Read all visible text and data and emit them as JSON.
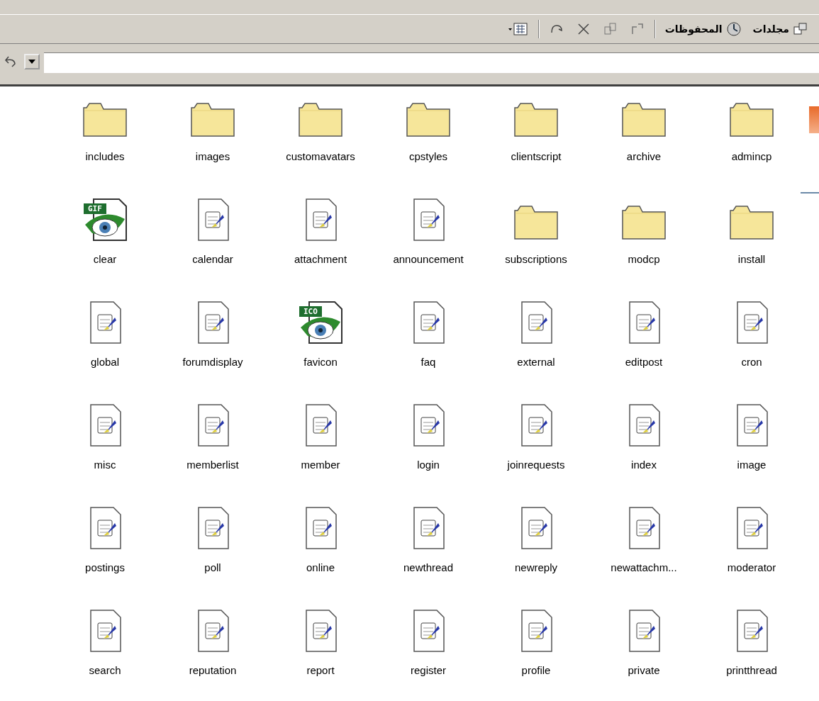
{
  "toolbar": {
    "buttons": [
      {
        "kind": "folders",
        "label": "مجلدات"
      },
      {
        "kind": "history",
        "label": "المحفوظات"
      },
      {
        "kind": "separator"
      },
      {
        "kind": "move"
      },
      {
        "kind": "copy"
      },
      {
        "kind": "delete"
      },
      {
        "kind": "undo"
      },
      {
        "kind": "separator"
      },
      {
        "kind": "views"
      }
    ]
  },
  "items": [
    {
      "kind": "folder",
      "name": "includes"
    },
    {
      "kind": "folder",
      "name": "images"
    },
    {
      "kind": "folder",
      "name": "customavatars"
    },
    {
      "kind": "folder",
      "name": "cpstyles"
    },
    {
      "kind": "folder",
      "name": "clientscript"
    },
    {
      "kind": "folder",
      "name": "archive"
    },
    {
      "kind": "folder",
      "name": "admincp"
    },
    {
      "kind": "image",
      "badge": "GIF",
      "name": "clear"
    },
    {
      "kind": "script",
      "name": "calendar"
    },
    {
      "kind": "script",
      "name": "attachment"
    },
    {
      "kind": "script",
      "name": "announcement"
    },
    {
      "kind": "folder",
      "name": "subscriptions"
    },
    {
      "kind": "folder",
      "name": "modcp"
    },
    {
      "kind": "folder",
      "name": "install"
    },
    {
      "kind": "script",
      "name": "global"
    },
    {
      "kind": "script",
      "name": "forumdisplay"
    },
    {
      "kind": "image",
      "badge": "ICO",
      "name": "favicon"
    },
    {
      "kind": "script",
      "name": "faq"
    },
    {
      "kind": "script",
      "name": "external"
    },
    {
      "kind": "script",
      "name": "editpost"
    },
    {
      "kind": "script",
      "name": "cron"
    },
    {
      "kind": "script",
      "name": "misc"
    },
    {
      "kind": "script",
      "name": "memberlist"
    },
    {
      "kind": "script",
      "name": "member"
    },
    {
      "kind": "script",
      "name": "login"
    },
    {
      "kind": "script",
      "name": "joinrequests"
    },
    {
      "kind": "script",
      "name": "index"
    },
    {
      "kind": "script",
      "name": "image"
    },
    {
      "kind": "script",
      "name": "postings"
    },
    {
      "kind": "script",
      "name": "poll"
    },
    {
      "kind": "script",
      "name": "online"
    },
    {
      "kind": "script",
      "name": "newthread"
    },
    {
      "kind": "script",
      "name": "newreply"
    },
    {
      "kind": "script",
      "name": "newattachm..."
    },
    {
      "kind": "script",
      "name": "moderator"
    },
    {
      "kind": "script",
      "name": "search"
    },
    {
      "kind": "script",
      "name": "reputation"
    },
    {
      "kind": "script",
      "name": "report"
    },
    {
      "kind": "script",
      "name": "register"
    },
    {
      "kind": "script",
      "name": "profile"
    },
    {
      "kind": "script",
      "name": "private"
    },
    {
      "kind": "script",
      "name": "printthread"
    }
  ]
}
